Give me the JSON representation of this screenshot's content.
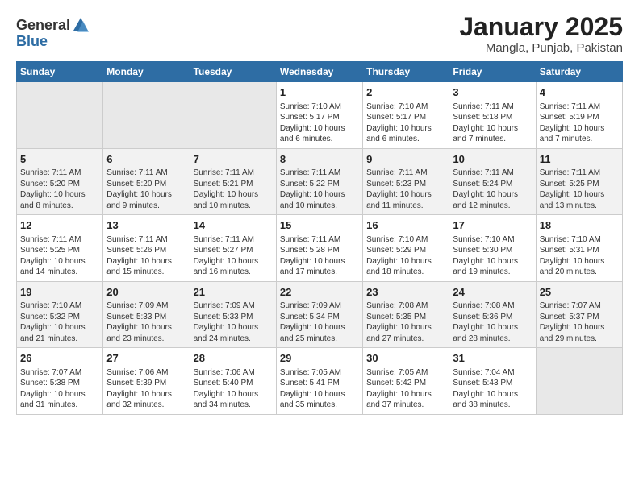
{
  "header": {
    "logo_general": "General",
    "logo_blue": "Blue",
    "title": "January 2025",
    "subtitle": "Mangla, Punjab, Pakistan"
  },
  "weekdays": [
    "Sunday",
    "Monday",
    "Tuesday",
    "Wednesday",
    "Thursday",
    "Friday",
    "Saturday"
  ],
  "weeks": [
    [
      {
        "day": "",
        "sunrise": "",
        "sunset": "",
        "daylight": "",
        "empty": true
      },
      {
        "day": "",
        "sunrise": "",
        "sunset": "",
        "daylight": "",
        "empty": true
      },
      {
        "day": "",
        "sunrise": "",
        "sunset": "",
        "daylight": "",
        "empty": true
      },
      {
        "day": "1",
        "sunrise": "Sunrise: 7:10 AM",
        "sunset": "Sunset: 5:17 PM",
        "daylight": "Daylight: 10 hours and 6 minutes."
      },
      {
        "day": "2",
        "sunrise": "Sunrise: 7:10 AM",
        "sunset": "Sunset: 5:17 PM",
        "daylight": "Daylight: 10 hours and 6 minutes."
      },
      {
        "day": "3",
        "sunrise": "Sunrise: 7:11 AM",
        "sunset": "Sunset: 5:18 PM",
        "daylight": "Daylight: 10 hours and 7 minutes."
      },
      {
        "day": "4",
        "sunrise": "Sunrise: 7:11 AM",
        "sunset": "Sunset: 5:19 PM",
        "daylight": "Daylight: 10 hours and 7 minutes."
      }
    ],
    [
      {
        "day": "5",
        "sunrise": "Sunrise: 7:11 AM",
        "sunset": "Sunset: 5:20 PM",
        "daylight": "Daylight: 10 hours and 8 minutes."
      },
      {
        "day": "6",
        "sunrise": "Sunrise: 7:11 AM",
        "sunset": "Sunset: 5:20 PM",
        "daylight": "Daylight: 10 hours and 9 minutes."
      },
      {
        "day": "7",
        "sunrise": "Sunrise: 7:11 AM",
        "sunset": "Sunset: 5:21 PM",
        "daylight": "Daylight: 10 hours and 10 minutes."
      },
      {
        "day": "8",
        "sunrise": "Sunrise: 7:11 AM",
        "sunset": "Sunset: 5:22 PM",
        "daylight": "Daylight: 10 hours and 10 minutes."
      },
      {
        "day": "9",
        "sunrise": "Sunrise: 7:11 AM",
        "sunset": "Sunset: 5:23 PM",
        "daylight": "Daylight: 10 hours and 11 minutes."
      },
      {
        "day": "10",
        "sunrise": "Sunrise: 7:11 AM",
        "sunset": "Sunset: 5:24 PM",
        "daylight": "Daylight: 10 hours and 12 minutes."
      },
      {
        "day": "11",
        "sunrise": "Sunrise: 7:11 AM",
        "sunset": "Sunset: 5:25 PM",
        "daylight": "Daylight: 10 hours and 13 minutes."
      }
    ],
    [
      {
        "day": "12",
        "sunrise": "Sunrise: 7:11 AM",
        "sunset": "Sunset: 5:25 PM",
        "daylight": "Daylight: 10 hours and 14 minutes."
      },
      {
        "day": "13",
        "sunrise": "Sunrise: 7:11 AM",
        "sunset": "Sunset: 5:26 PM",
        "daylight": "Daylight: 10 hours and 15 minutes."
      },
      {
        "day": "14",
        "sunrise": "Sunrise: 7:11 AM",
        "sunset": "Sunset: 5:27 PM",
        "daylight": "Daylight: 10 hours and 16 minutes."
      },
      {
        "day": "15",
        "sunrise": "Sunrise: 7:11 AM",
        "sunset": "Sunset: 5:28 PM",
        "daylight": "Daylight: 10 hours and 17 minutes."
      },
      {
        "day": "16",
        "sunrise": "Sunrise: 7:10 AM",
        "sunset": "Sunset: 5:29 PM",
        "daylight": "Daylight: 10 hours and 18 minutes."
      },
      {
        "day": "17",
        "sunrise": "Sunrise: 7:10 AM",
        "sunset": "Sunset: 5:30 PM",
        "daylight": "Daylight: 10 hours and 19 minutes."
      },
      {
        "day": "18",
        "sunrise": "Sunrise: 7:10 AM",
        "sunset": "Sunset: 5:31 PM",
        "daylight": "Daylight: 10 hours and 20 minutes."
      }
    ],
    [
      {
        "day": "19",
        "sunrise": "Sunrise: 7:10 AM",
        "sunset": "Sunset: 5:32 PM",
        "daylight": "Daylight: 10 hours and 21 minutes."
      },
      {
        "day": "20",
        "sunrise": "Sunrise: 7:09 AM",
        "sunset": "Sunset: 5:33 PM",
        "daylight": "Daylight: 10 hours and 23 minutes."
      },
      {
        "day": "21",
        "sunrise": "Sunrise: 7:09 AM",
        "sunset": "Sunset: 5:33 PM",
        "daylight": "Daylight: 10 hours and 24 minutes."
      },
      {
        "day": "22",
        "sunrise": "Sunrise: 7:09 AM",
        "sunset": "Sunset: 5:34 PM",
        "daylight": "Daylight: 10 hours and 25 minutes."
      },
      {
        "day": "23",
        "sunrise": "Sunrise: 7:08 AM",
        "sunset": "Sunset: 5:35 PM",
        "daylight": "Daylight: 10 hours and 27 minutes."
      },
      {
        "day": "24",
        "sunrise": "Sunrise: 7:08 AM",
        "sunset": "Sunset: 5:36 PM",
        "daylight": "Daylight: 10 hours and 28 minutes."
      },
      {
        "day": "25",
        "sunrise": "Sunrise: 7:07 AM",
        "sunset": "Sunset: 5:37 PM",
        "daylight": "Daylight: 10 hours and 29 minutes."
      }
    ],
    [
      {
        "day": "26",
        "sunrise": "Sunrise: 7:07 AM",
        "sunset": "Sunset: 5:38 PM",
        "daylight": "Daylight: 10 hours and 31 minutes."
      },
      {
        "day": "27",
        "sunrise": "Sunrise: 7:06 AM",
        "sunset": "Sunset: 5:39 PM",
        "daylight": "Daylight: 10 hours and 32 minutes."
      },
      {
        "day": "28",
        "sunrise": "Sunrise: 7:06 AM",
        "sunset": "Sunset: 5:40 PM",
        "daylight": "Daylight: 10 hours and 34 minutes."
      },
      {
        "day": "29",
        "sunrise": "Sunrise: 7:05 AM",
        "sunset": "Sunset: 5:41 PM",
        "daylight": "Daylight: 10 hours and 35 minutes."
      },
      {
        "day": "30",
        "sunrise": "Sunrise: 7:05 AM",
        "sunset": "Sunset: 5:42 PM",
        "daylight": "Daylight: 10 hours and 37 minutes."
      },
      {
        "day": "31",
        "sunrise": "Sunrise: 7:04 AM",
        "sunset": "Sunset: 5:43 PM",
        "daylight": "Daylight: 10 hours and 38 minutes."
      },
      {
        "day": "",
        "sunrise": "",
        "sunset": "",
        "daylight": "",
        "empty": true
      }
    ]
  ]
}
